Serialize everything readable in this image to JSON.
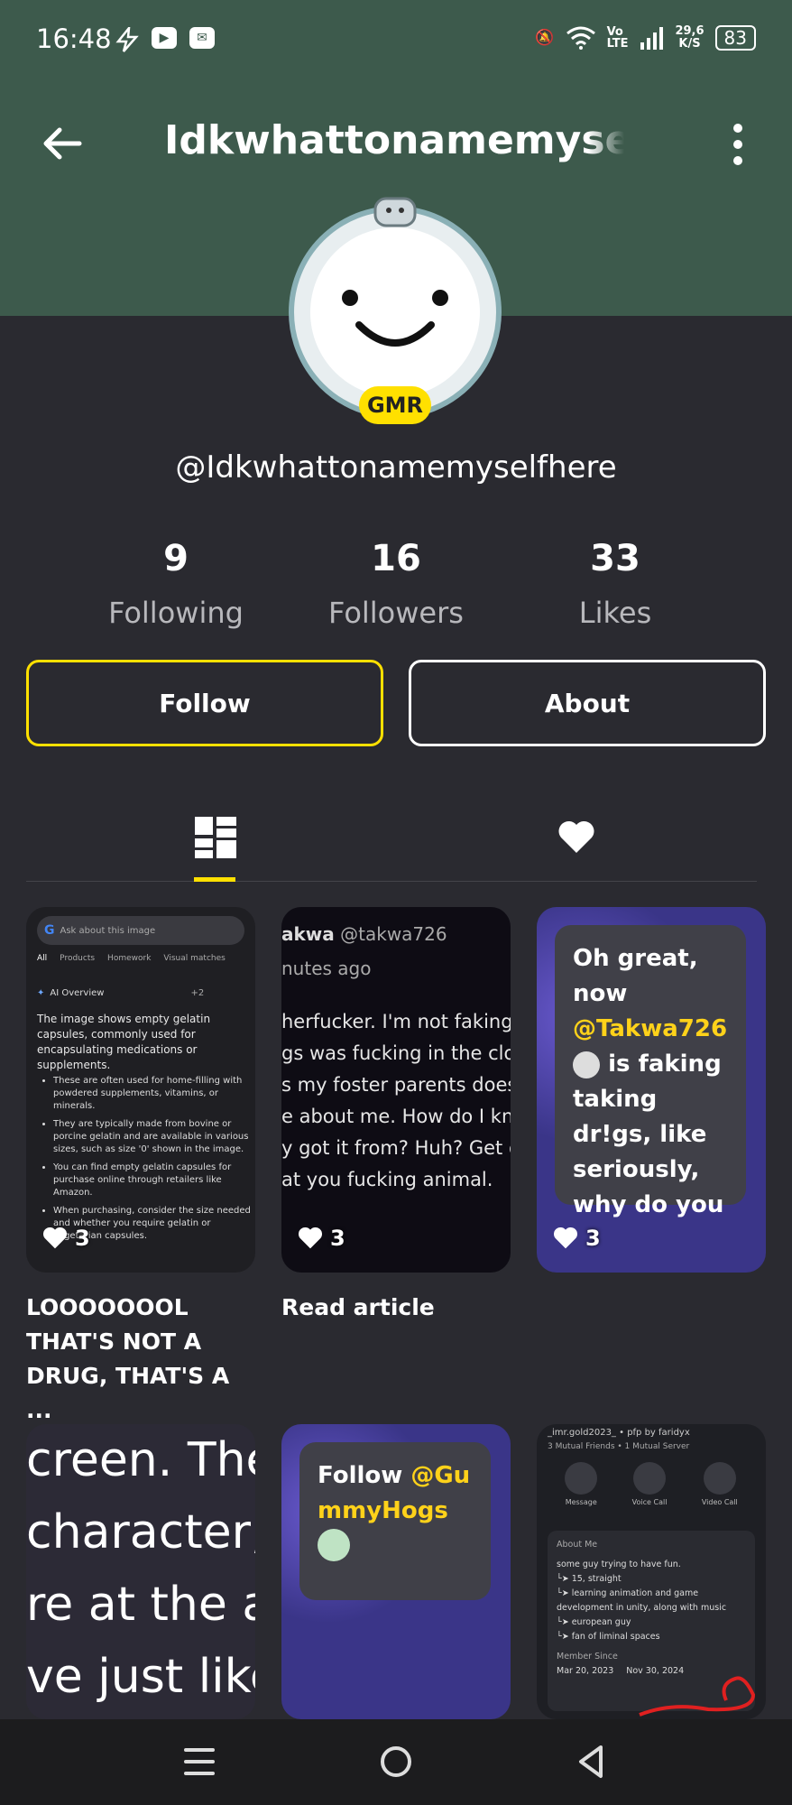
{
  "status_bar": {
    "time": "16:48",
    "net_badge": "Vo\nLTE",
    "speed_value": "29,6",
    "speed_unit": "K/S",
    "battery": "83"
  },
  "app_bar": {
    "title": "Idkwhattonamemyselfhere"
  },
  "profile": {
    "badge": "GMR",
    "handle": "@Idkwhattonamemyselfhere"
  },
  "stats": [
    {
      "value": "9",
      "label": "Following"
    },
    {
      "value": "16",
      "label": "Followers"
    },
    {
      "value": "33",
      "label": "Likes"
    }
  ],
  "actions": {
    "follow": "Follow",
    "about": "About"
  },
  "tabs": {
    "active": "posts"
  },
  "posts": [
    {
      "likes": "3",
      "caption": "LOOOOOOOL THAT'S NOT A DRUG, THAT'S A ...",
      "preview": {
        "search_placeholder": "Ask about this image",
        "tabs": [
          "All",
          "Products",
          "Homework",
          "Visual matches"
        ],
        "overview": "AI Overview",
        "count": "+2",
        "text": "The image shows empty gelatin capsules, commonly used for encapsulating medications or supplements.",
        "bullets": [
          "These are often used for home-filling with powdered supplements, vitamins, or minerals.",
          "They are typically made from bovine or porcine gelatin and are available in various sizes, such as size '0' shown in the image.",
          "You can find empty gelatin capsules for purchase online through retailers like Amazon.",
          "When purchasing, consider the size needed and whether you require gelatin or vegetarian capsules."
        ]
      }
    },
    {
      "likes": "3",
      "caption": "Read article",
      "preview": {
        "user": "akwa",
        "handle": "@takwa726",
        "time": "nutes ago",
        "lines": [
          "herfucker. I'm not faking",
          "gs was fucking in the clo",
          "s my foster parents does",
          "e about me. How do I kn",
          "y got it from? Huh? Get o",
          "at you fucking animal."
        ]
      }
    },
    {
      "likes": "3",
      "caption": "",
      "preview": {
        "text1": "Oh great, now",
        "mention": "@Takwa726",
        "text2": "is faking taking dr!gs, like seriously, why do you"
      }
    },
    {
      "likes": "",
      "caption": "",
      "preview": {
        "lines": [
          "creen. The",
          "character,",
          "re at the a",
          "ve just like"
        ]
      }
    },
    {
      "likes": "",
      "caption": "",
      "preview": {
        "text": "Follow ",
        "mention": "@GummyHogs"
      }
    },
    {
      "likes": "",
      "caption": "",
      "preview": {
        "top": "_imr.gold2023_ • pfp by faridyx",
        "mutuals": "3 Mutual Friends • 1 Mutual Server",
        "buttons": [
          "Message",
          "Voice Call",
          "Video Call"
        ],
        "about_title": "About Me",
        "about_lines": [
          "some guy trying to have fun.",
          "└➤ 15, straight",
          "└➤ learning animation and game development in unity, along with music",
          "└➤ european guy",
          "└➤ fan of liminal spaces"
        ],
        "member_since": "Member Since",
        "date1": "Mar 20, 2023",
        "date2": "Nov 30, 2024"
      }
    }
  ],
  "colors": {
    "header": "#3d5a4c",
    "background": "#2a2a30",
    "accent": "#ffe000"
  }
}
